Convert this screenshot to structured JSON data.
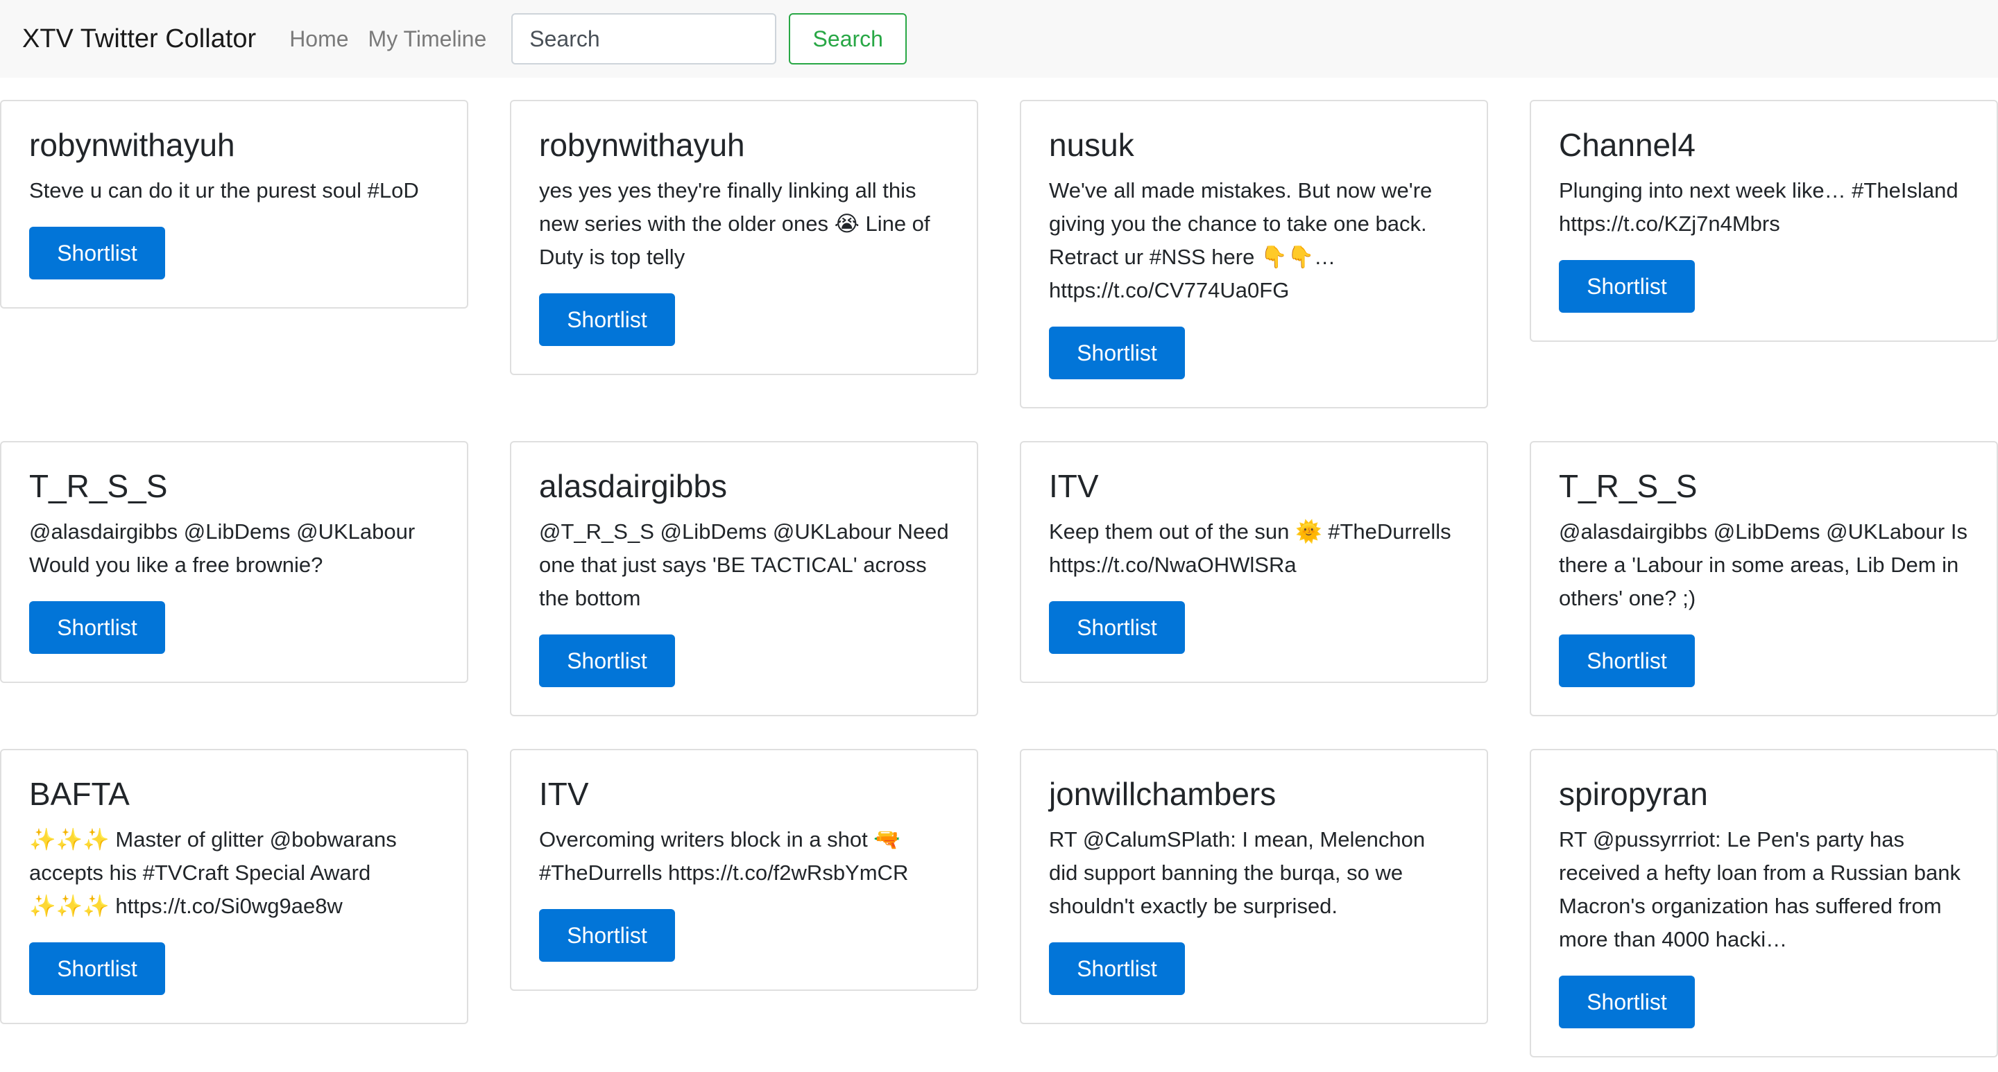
{
  "navbar": {
    "brand": "XTV Twitter Collator",
    "links": [
      "Home",
      "My Timeline"
    ],
    "search_placeholder": "Search",
    "search_button": "Search"
  },
  "cards": [
    {
      "user": "robynwithayuh",
      "text": "Steve u can do it ur the purest soul #LoD",
      "button": "Shortlist"
    },
    {
      "user": "robynwithayuh",
      "text": "yes yes yes they're finally linking all this new series with the older ones 😭 Line of Duty is top telly",
      "button": "Shortlist"
    },
    {
      "user": "nusuk",
      "text": "We've all made mistakes. But now we're giving you the chance to take one back. Retract ur #NSS here 👇👇… https://t.co/CV774Ua0FG",
      "button": "Shortlist"
    },
    {
      "user": "Channel4",
      "text": "Plunging into next week like… #TheIsland https://t.co/KZj7n4Mbrs",
      "button": "Shortlist"
    },
    {
      "user": "T_R_S_S",
      "text": "@alasdairgibbs @LibDems @UKLabour Would you like a free brownie?",
      "button": "Shortlist"
    },
    {
      "user": "alasdairgibbs",
      "text": "@T_R_S_S @LibDems @UKLabour Need one that just says 'BE TACTICAL' across the bottom",
      "button": "Shortlist"
    },
    {
      "user": "ITV",
      "text": "Keep them out of the sun 🌞 #TheDurrells https://t.co/NwaOHWlSRa",
      "button": "Shortlist"
    },
    {
      "user": "T_R_S_S",
      "text": "@alasdairgibbs @LibDems @UKLabour Is there a 'Labour in some areas, Lib Dem in others' one? ;)",
      "button": "Shortlist"
    },
    {
      "user": "BAFTA",
      "text": "✨✨✨ Master of glitter @bobwarans accepts his #TVCraft Special Award ✨✨✨ https://t.co/Si0wg9ae8w",
      "button": "Shortlist"
    },
    {
      "user": "ITV",
      "text": "Overcoming writers block in a shot 🔫 #TheDurrells https://t.co/f2wRsbYmCR",
      "button": "Shortlist"
    },
    {
      "user": "jonwillchambers",
      "text": "RT @CalumSPlath: I mean, Melenchon did support banning the burqa, so we shouldn't exactly be surprised.",
      "button": "Shortlist"
    },
    {
      "user": "spiropyran",
      "text": "RT @pussyrrriot: Le Pen's party has received a hefty loan from a Russian bank Macron's organization has suffered from more than 4000 hacki…",
      "button": "Shortlist"
    }
  ]
}
